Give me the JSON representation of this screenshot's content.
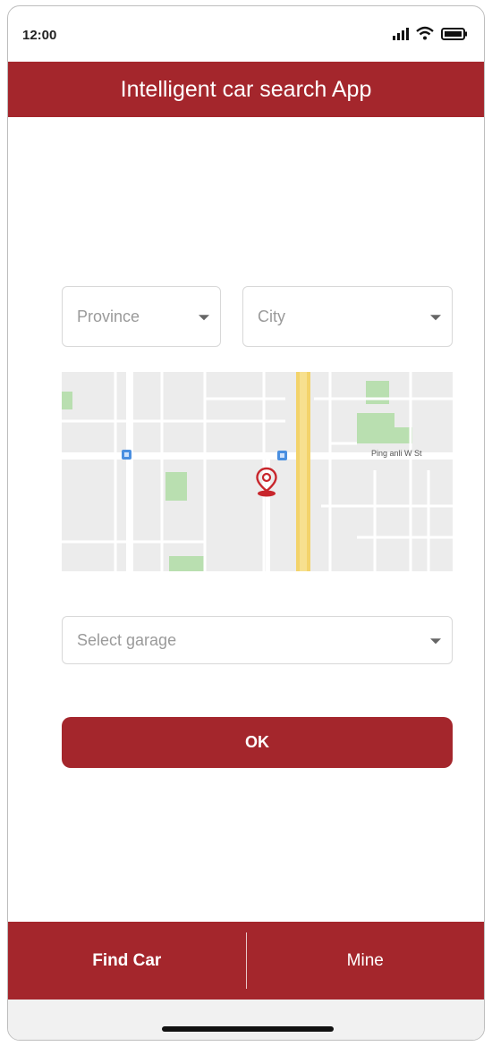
{
  "status_bar": {
    "time": "12:00"
  },
  "header": {
    "title": "Intelligent car search App"
  },
  "form": {
    "province_placeholder": "Province",
    "city_placeholder": "City",
    "garage_placeholder": "Select garage",
    "ok_label": "OK"
  },
  "map": {
    "street_label": "Ping anli W St"
  },
  "bottom_nav": {
    "items": [
      {
        "label": "Find Car",
        "active": true
      },
      {
        "label": "Mine",
        "active": false
      }
    ]
  },
  "colors": {
    "brand": "#a4262c",
    "road_highlight": "#f3d36b",
    "park": "#b9dfb0",
    "map_background": "#ececec"
  },
  "icons": [
    "signal-icon",
    "wifi-icon",
    "battery-icon",
    "chevron-down-icon",
    "location-pin-icon",
    "transit-icon"
  ]
}
